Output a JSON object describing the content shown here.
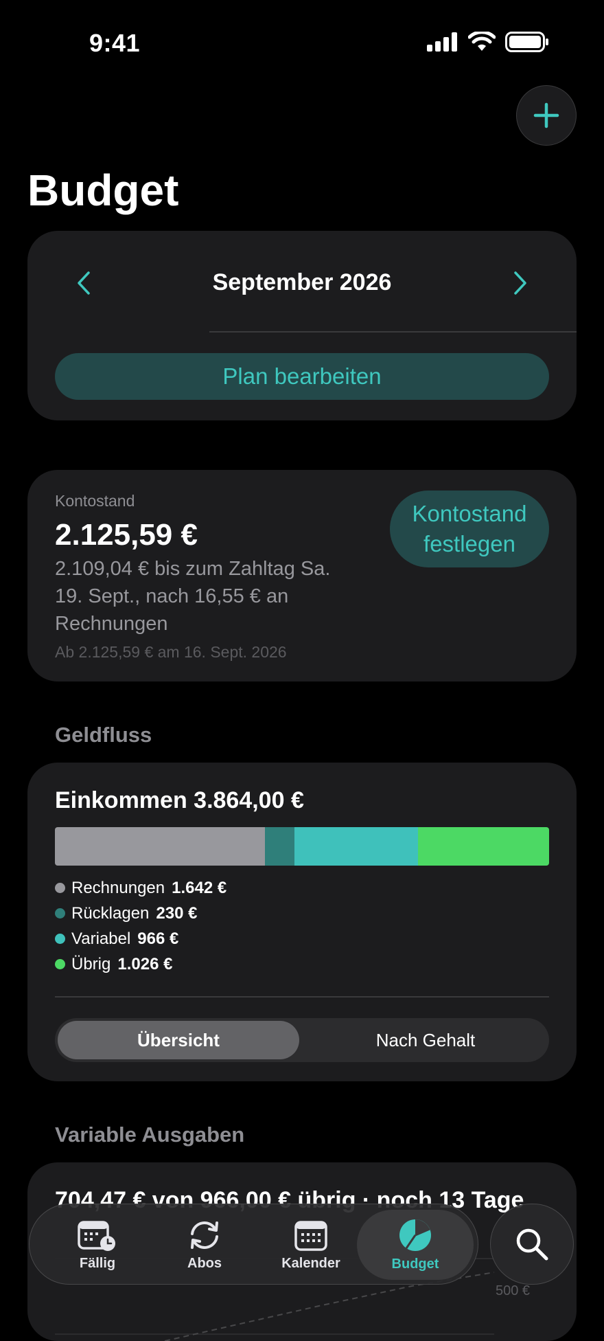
{
  "status_bar": {
    "time": "9:41"
  },
  "header": {
    "title": "Budget"
  },
  "month_selector": {
    "label": "September 2026",
    "edit_plan_label": "Plan bearbeiten"
  },
  "balance": {
    "label": "Kontostand",
    "value": "2.125,59 €",
    "description": "2.109,04 € bis zum Zahltag Sa. 19. Sept., nach 16,55 € an Rechnungen",
    "note": "Ab 2.125,59 € am 16. Sept. 2026",
    "set_button_label": "Kontostand festlegen"
  },
  "cashflow": {
    "section_title": "Geldfluss",
    "income_title": "Einkommen 3.864,00 €",
    "segments": [
      {
        "name": "Rechnungen",
        "value_label": "1.642 €",
        "amount": 1642,
        "color": "#98989d"
      },
      {
        "name": "Rücklagen",
        "value_label": "230 €",
        "amount": 230,
        "color": "#2f7f7a"
      },
      {
        "name": "Variabel",
        "value_label": "966 €",
        "amount": 966,
        "color": "#3fc1bb"
      },
      {
        "name": "Übrig",
        "value_label": "1.026 €",
        "amount": 1026,
        "color": "#4cd964"
      }
    ],
    "view_tabs": [
      {
        "label": "Übersicht",
        "selected": true
      },
      {
        "label": "Nach Gehalt",
        "selected": false
      }
    ]
  },
  "variable_expenses": {
    "section_title": "Variable Ausgaben",
    "summary": "704,47 € von 966,00 € übrig · noch 13 Tage",
    "axis_tick": "500 €"
  },
  "tab_bar": {
    "tabs": [
      {
        "label": "Fällig",
        "icon": "calendar-clock-icon",
        "active": false
      },
      {
        "label": "Abos",
        "icon": "refresh-icon",
        "active": false
      },
      {
        "label": "Kalender",
        "icon": "calendar-icon",
        "active": false
      },
      {
        "label": "Budget",
        "icon": "pie-chart-icon",
        "active": true
      }
    ],
    "search_icon": "search-icon"
  },
  "colors": {
    "accent": "#3fc8bf",
    "card": "#1c1c1e",
    "background": "#000000"
  }
}
